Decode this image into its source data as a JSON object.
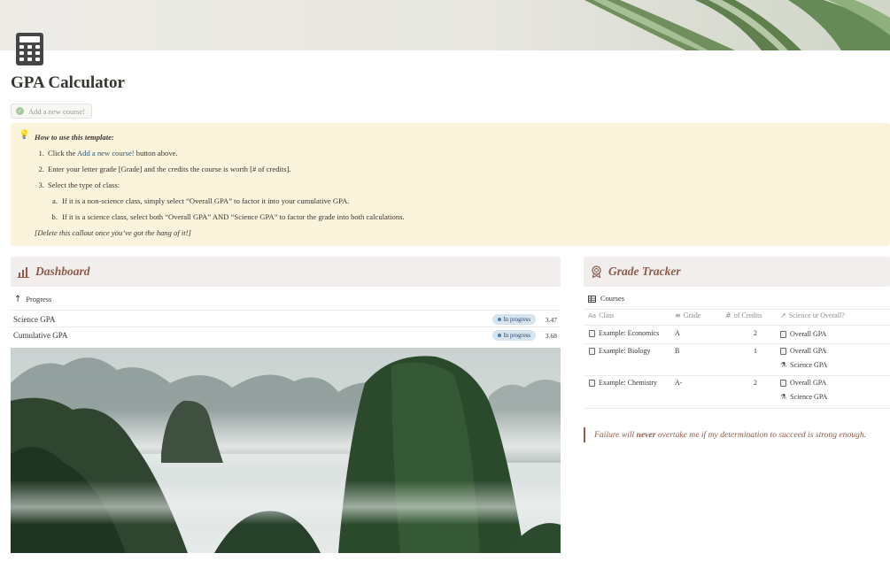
{
  "page": {
    "title": "GPA Calculator",
    "icon": "calculator-icon",
    "add_button_label": "Add a new course!"
  },
  "callout": {
    "icon": "lightbulb-icon",
    "heading": "How to use this template:",
    "step1_prefix": "Click the",
    "step1_link": "Add a new course!",
    "step1_suffix": "button above.",
    "step2": "Enter your letter grade [Grade] and the credits the course is worth [# of credits].",
    "step3": "Select the type of class:",
    "step3a": "If it is a non-science class, simply select “Overall GPA” to factor it into your cumulative GPA.",
    "step3b": "If it is a science class, select both “Overall GPA” AND “Science GPA” to factor the grade into both calculations.",
    "footer": "[Delete this callout once you’ve got the hang of it!]",
    "numbers": [
      "1.",
      "2.",
      "3.",
      "a.",
      "b."
    ]
  },
  "dashboard": {
    "title": "Dashboard",
    "view_label": "Progress",
    "rows": [
      {
        "name": "Science GPA",
        "status": "In progress",
        "value": "3.47"
      },
      {
        "name": "Cumulative GPA",
        "status": "In progress",
        "value": "3.68"
      }
    ]
  },
  "grade_tracker": {
    "title": "Grade Tracker",
    "view_label": "Courses",
    "columns": {
      "class": "Class",
      "grade": "Grade",
      "credits": "of Credits",
      "type": "Science or Overall?"
    },
    "column_icons": {
      "class": "Aa",
      "credits": "#"
    },
    "rows": [
      {
        "class": "Example: Economics",
        "grade": "A",
        "credits": "2",
        "tags": [
          "Overall GPA"
        ]
      },
      {
        "class": "Example: Biology",
        "grade": "B",
        "credits": "1",
        "tags": [
          "Overall GPA",
          "Science GPA"
        ]
      },
      {
        "class": "Example: Chemistry",
        "grade": "A-",
        "credits": "2",
        "tags": [
          "Overall GPA",
          "Science GPA"
        ]
      }
    ]
  },
  "quote": {
    "before": "Failure will",
    "bold": "never",
    "after": "overtake me if my determination to succeed is strong enough."
  },
  "colors": {
    "accent": "#8c5b4a",
    "callout_bg": "#fbf3db",
    "section_bg": "#f1eeed",
    "badge_bg": "#d5e4ef"
  }
}
